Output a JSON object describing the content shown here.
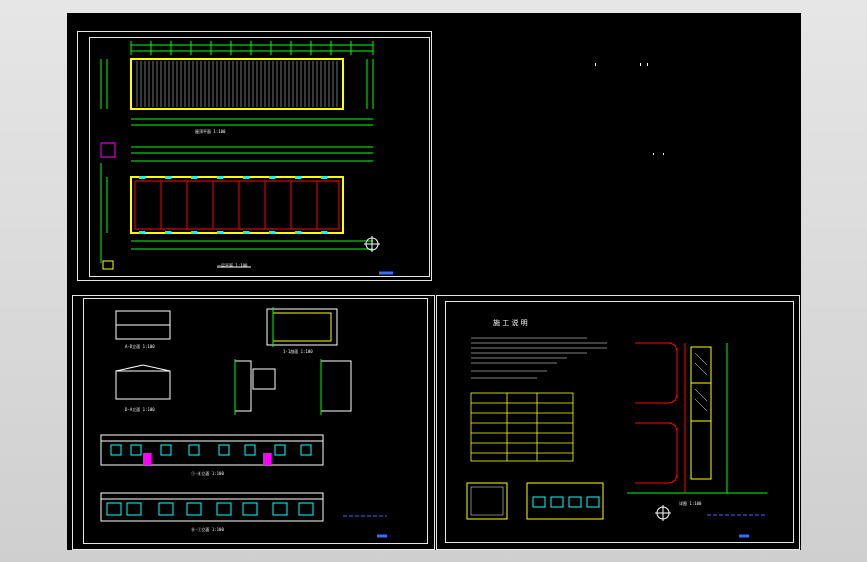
{
  "app": {
    "title": ""
  },
  "drawing": {
    "sheet1": {
      "plan_title": "一层平面 1:100",
      "roof_title": "屋顶平面 1:100"
    },
    "sheet2": {
      "elev_a": "①-⑧立面 1:100",
      "elev_b": "⑧-①立面 1:100",
      "section": "1-1剖面 1:100",
      "side_a": "A-D立面 1:100",
      "side_b": "D-A立面 1:100"
    },
    "sheet3": {
      "heading": "施 工 说 明",
      "detail_title": "详图 1:100"
    }
  },
  "colors": {
    "bg": "#000000",
    "border": "#e6e6e6",
    "yellow": "#ffff00",
    "red": "#ff0000",
    "green": "#00ff00",
    "cyan": "#00ffff",
    "magenta": "#ff00ff",
    "blue": "#3a6bff",
    "white": "#ffffff"
  }
}
